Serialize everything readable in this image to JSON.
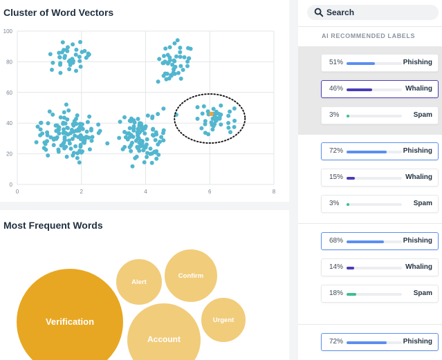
{
  "cluster_card": {
    "title": "Cluster of Word Vectors"
  },
  "chart_data": {
    "type": "scatter",
    "title": "Cluster of Word Vectors",
    "xlabel": "",
    "ylabel": "",
    "xlim": [
      0,
      8
    ],
    "ylim": [
      0,
      100
    ],
    "x_ticks": [
      "0",
      "2",
      "4",
      "6",
      "8"
    ],
    "y_ticks": [
      "0",
      "20",
      "40",
      "60",
      "80",
      "100"
    ],
    "grid": true,
    "point_color": "#52b6cf",
    "highlight_point_color": "#f2a23a",
    "clusters": [
      {
        "center": [
          1.7,
          83
        ],
        "count": 40,
        "spread": [
          0.65,
          10
        ]
      },
      {
        "center": [
          4.8,
          81
        ],
        "count": 45,
        "spread": [
          0.55,
          14
        ]
      },
      {
        "center": [
          1.6,
          32
        ],
        "count": 120,
        "spread": [
          0.85,
          15
        ]
      },
      {
        "center": [
          3.9,
          30
        ],
        "count": 95,
        "spread": [
          0.75,
          15
        ]
      },
      {
        "center": [
          6.1,
          43
        ],
        "count": 40,
        "spread": [
          0.8,
          9
        ]
      }
    ],
    "highlight_point": [
      6.05,
      46
    ],
    "annotation": {
      "type": "dashed-ellipse",
      "center": [
        6.0,
        43
      ],
      "radii": [
        1.1,
        16
      ]
    }
  },
  "words_card": {
    "title": "Most Frequent Words",
    "bubbles": [
      {
        "label": "Verification",
        "color": "#e8a722",
        "weight": "large"
      },
      {
        "label": "Alert",
        "color": "#f1cc7b",
        "weight": "small"
      },
      {
        "label": "Confirm",
        "color": "#f1cc7b",
        "weight": "medium"
      },
      {
        "label": "Account",
        "color": "#f1cc7b",
        "weight": "large"
      },
      {
        "label": "Urgent",
        "color": "#f1cc7b",
        "weight": "small"
      }
    ]
  },
  "right_panel": {
    "search": {
      "label": "Search",
      "icon": "search-icon"
    },
    "header": "AI RECOMMENDED LABELS",
    "groups": [
      {
        "highlighted": true,
        "labels": [
          {
            "pct": "51%",
            "value": 0.51,
            "name": "Phishing",
            "color": "#5b8ff0",
            "state": "none"
          },
          {
            "pct": "46%",
            "value": 0.46,
            "name": "Whaling",
            "color": "#4b3cb8",
            "state": "purple"
          },
          {
            "pct": "3%",
            "value": 0.03,
            "name": "Spam",
            "color": "#3cbf8f",
            "state": "none"
          }
        ]
      },
      {
        "highlighted": false,
        "labels": [
          {
            "pct": "72%",
            "value": 0.72,
            "name": "Phishing",
            "color": "#5b8ff0",
            "state": "blue"
          },
          {
            "pct": "15%",
            "value": 0.15,
            "name": "Whaling",
            "color": "#4b3cb8",
            "state": "none"
          },
          {
            "pct": "3%",
            "value": 0.03,
            "name": "Spam",
            "color": "#3cbf8f",
            "state": "none"
          }
        ]
      },
      {
        "highlighted": false,
        "labels": [
          {
            "pct": "68%",
            "value": 0.68,
            "name": "Phishing",
            "color": "#5b8ff0",
            "state": "blue"
          },
          {
            "pct": "14%",
            "value": 0.14,
            "name": "Whaling",
            "color": "#4b3cb8",
            "state": "none"
          },
          {
            "pct": "18%",
            "value": 0.18,
            "name": "Spam",
            "color": "#3cbf8f",
            "state": "none"
          }
        ]
      },
      {
        "highlighted": false,
        "labels": [
          {
            "pct": "72%",
            "value": 0.72,
            "name": "Phishing",
            "color": "#5b8ff0",
            "state": "blue"
          }
        ]
      }
    ]
  }
}
